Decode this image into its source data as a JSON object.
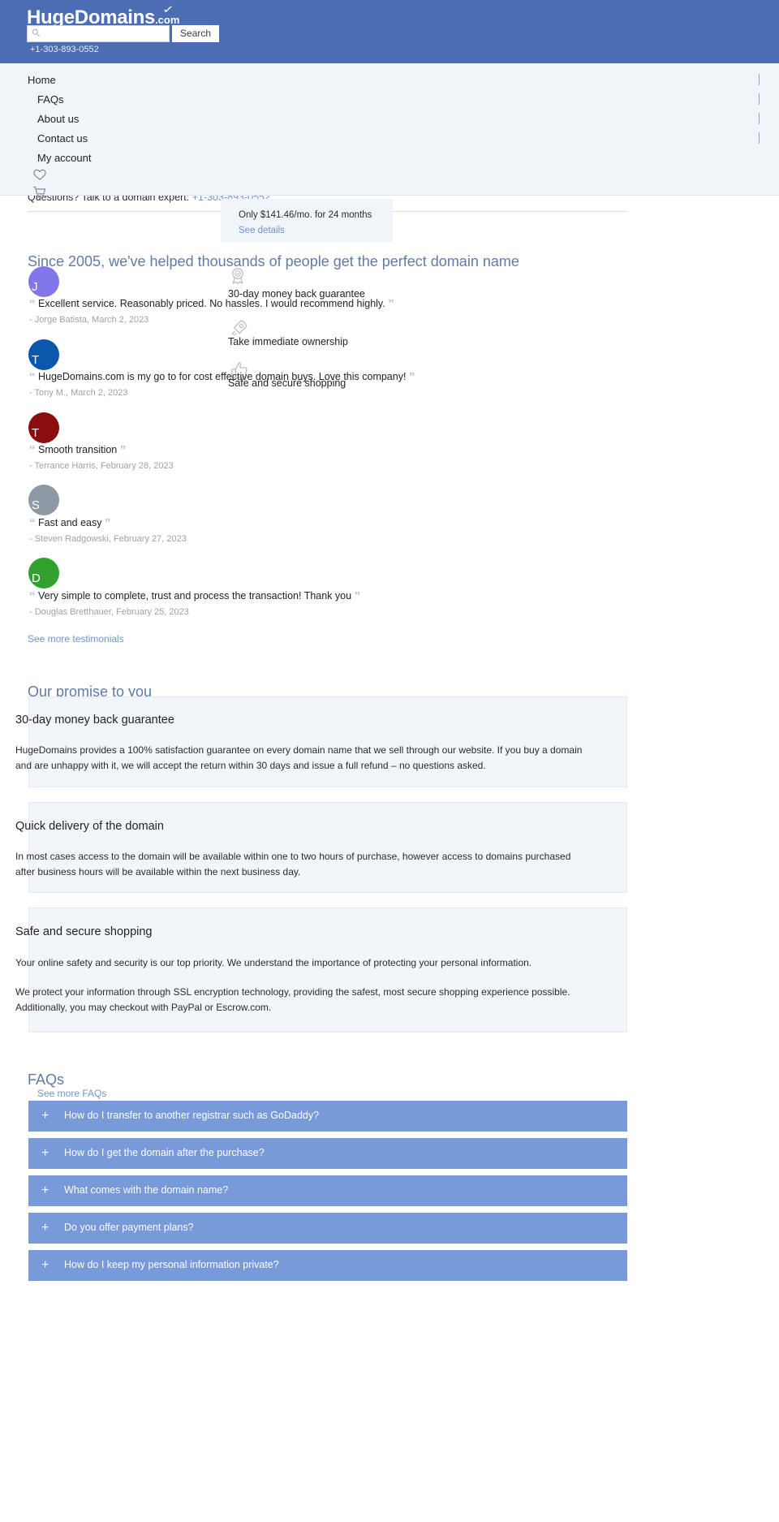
{
  "header": {
    "logo_main": "HugeDomains",
    "logo_tld": ".com",
    "search_value": "",
    "search_placeholder": "",
    "search_button": "Search",
    "phone": "+1-303-893-0552"
  },
  "nav": {
    "items": [
      {
        "label": "Home"
      },
      {
        "label": "FAQs"
      },
      {
        "label": "About us"
      },
      {
        "label": "Contact us"
      },
      {
        "label": "My account"
      }
    ],
    "icons": [
      {
        "name": "heart-icon"
      },
      {
        "name": "cart-icon"
      }
    ]
  },
  "expert_bar": {
    "text": "Questions? Talk to a domain expert:",
    "phone": "+1-303-893-0552"
  },
  "price_box": {
    "text": "Only $141.46/mo. for 24 months",
    "link": "See details",
    "amount": "$141.46",
    "months": "24"
  },
  "testimonials_section": {
    "heading": "Since 2005, we've helped thousands of people get the perfect domain name",
    "see_more": "See more testimonials",
    "items": [
      {
        "initial": "J",
        "color": "#8277ea",
        "quote": "Excellent service. Reasonably priced. No hassles. I would recommend highly.",
        "author": "- Jorge Batista, March 2, 2023"
      },
      {
        "initial": "T",
        "color": "#0a57ac",
        "quote": "HugeDomains.com is my go to for cost effective domain buys. Love this company!",
        "author": "- Tony M., March 2, 2023"
      },
      {
        "initial": "T",
        "color": "#8c0d0d",
        "quote": "Smooth transition",
        "author": "- Terrance Harris, February 28, 2023"
      },
      {
        "initial": "S",
        "color": "#8d99a4",
        "quote": "Fast and easy",
        "author": "- Steven Radgowski, February 27, 2023"
      },
      {
        "initial": "D",
        "color": "#31a02c",
        "quote": "Very simple to complete, trust and process the transaction! Thank you",
        "author": "- Douglas Bretthauer, February 25, 2023"
      }
    ]
  },
  "features": [
    {
      "icon": "badge-ribbon-icon",
      "label": "30-day money back guarantee"
    },
    {
      "icon": "rocket-icon",
      "label": "Take immediate ownership"
    },
    {
      "icon": "thumbs-up-icon",
      "label": "Safe and secure shopping"
    }
  ],
  "promise_section": {
    "heading": "Our promise to you",
    "cards": [
      {
        "title": "30-day money back guarantee",
        "paragraphs": [
          "HugeDomains provides a 100% satisfaction guarantee on every domain name that we sell through our website. If you buy a domain and are unhappy with it, we will accept the return within 30 days and issue a full refund – no questions asked."
        ]
      },
      {
        "title": "Quick delivery of the domain",
        "paragraphs": [
          "In most cases access to the domain will be available within one to two hours of purchase, however access to domains purchased after business hours will be available within the next business day."
        ]
      },
      {
        "title": "Safe and secure shopping",
        "paragraphs": [
          "Your online safety and security is our top priority. We understand the importance of protecting your personal information.",
          "We protect your information through SSL encryption technology, providing the safest, most secure shopping experience possible. Additionally, you may checkout with PayPal or Escrow.com."
        ]
      }
    ]
  },
  "faq_section": {
    "heading": "FAQs",
    "see_more": "See more FAQs",
    "items": [
      {
        "plus": "+",
        "question": "How do I transfer to another registrar such as GoDaddy?"
      },
      {
        "plus": "+",
        "question": "How do I get the domain after the purchase?"
      },
      {
        "plus": "+",
        "question": "What comes with the domain name?"
      },
      {
        "plus": "+",
        "question": "Do you offer payment plans?"
      },
      {
        "plus": "+",
        "question": "How do I keep my personal information private?"
      }
    ]
  },
  "colors": {
    "header_blue": "#4a6db3",
    "nav_bg": "#f1f5f9",
    "card_bg": "#f2f6fa",
    "faq_blue": "#789ad8",
    "link_blue": "#6f93cf",
    "heading_blue": "#5f7ba8"
  }
}
